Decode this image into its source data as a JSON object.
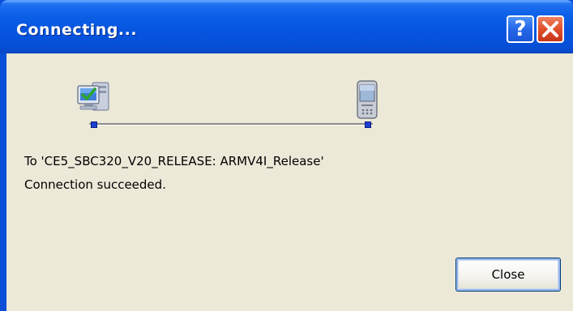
{
  "window": {
    "title": "Connecting...",
    "help_glyph": "?",
    "close_glyph": "X",
    "help_icon": "help-icon",
    "close_icon": "close-icon"
  },
  "connection": {
    "source_icon": "desktop-computer-icon",
    "target_icon": "handheld-device-icon",
    "target_text": "To 'CE5_SBC320_V20_RELEASE: ARMV4I_Release'",
    "status_text": "Connection succeeded."
  },
  "buttons": {
    "close_label": "Close"
  },
  "colors": {
    "titlebar": "#0654df",
    "client_background": "#ece9d8",
    "title_close_button": "#e0502a"
  }
}
